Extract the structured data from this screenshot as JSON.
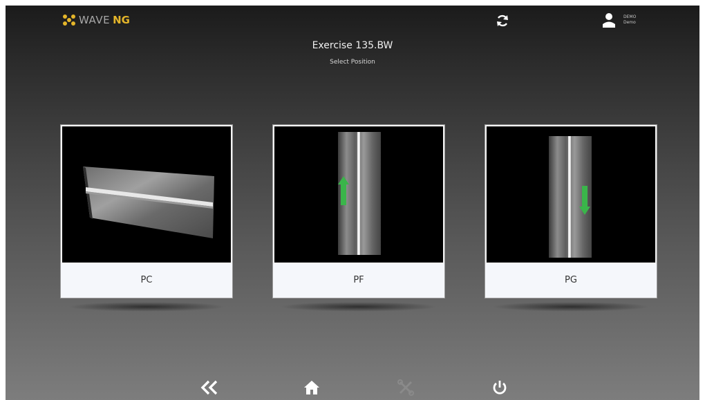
{
  "header": {
    "brand_primary": "WAVE",
    "brand_secondary": "NG",
    "user_line1": "DEMO",
    "user_line2": "Demo"
  },
  "page": {
    "title": "Exercise 135.BW",
    "subtitle": "Select Position"
  },
  "positions": [
    {
      "label": "PC"
    },
    {
      "label": "PF"
    },
    {
      "label": "PG"
    }
  ],
  "icons": {
    "logo": "flower-logo-icon",
    "refresh": "refresh-icon",
    "user": "user-icon",
    "back": "double-chevron-left-icon",
    "home": "home-icon",
    "tools": "tools-icon",
    "power": "power-icon"
  },
  "colors": {
    "accent": "#e4b52a",
    "arrow": "#3ab54a"
  }
}
